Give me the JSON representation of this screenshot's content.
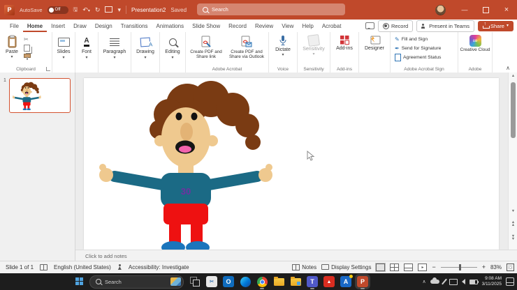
{
  "titlebar": {
    "autosave_label": "AutoSave",
    "autosave_state": "Off",
    "doc_title": "Presentation2",
    "doc_status": "Saved",
    "search_placeholder": "Search"
  },
  "tabs": {
    "items": [
      "File",
      "Home",
      "Insert",
      "Draw",
      "Design",
      "Transitions",
      "Animations",
      "Slide Show",
      "Record",
      "Review",
      "View",
      "Help",
      "Acrobat"
    ],
    "active": "Home",
    "record_button": "Record",
    "present_button": "Present in Teams",
    "share_button": "Share"
  },
  "ribbon": {
    "paste": "Paste",
    "clipboard_group": "Clipboard",
    "collapsed": [
      "Slides",
      "Font",
      "Paragraph",
      "Drawing",
      "Editing"
    ],
    "acrobat_btn1": "Create PDF and Share link",
    "acrobat_btn2": "Create PDF and Share via Outlook",
    "acrobat_group": "Adobe Acrobat",
    "dictate": "Dictate",
    "voice_group": "Voice",
    "sensitivity": "Sensitivity",
    "sensitivity_group": "Sensitivity",
    "addins": "Add-ins",
    "addins_group": "Add-ins",
    "designer": "Designer",
    "sign_items": [
      "Fill and Sign",
      "Send for Signature",
      "Agreement Status"
    ],
    "sign_group": "Adobe Acrobat Sign",
    "creative_cloud": "Creative Cloud",
    "adobe_group": "Adobe"
  },
  "slides_panel": {
    "slide_number": "1"
  },
  "slide": {
    "jersey_number": "30"
  },
  "notes_placeholder": "Click to add notes",
  "status": {
    "slide_indicator": "Slide 1 of 1",
    "language": "English (United States)",
    "accessibility": "Accessibility: Investigate",
    "notes_label": "Notes",
    "display_settings": "Display Settings",
    "zoom_level": "83%"
  },
  "taskbar": {
    "search_placeholder": "Search",
    "apps": [
      "start",
      "task-view",
      "snipping-tool",
      "outlook",
      "edge",
      "chrome",
      "file-explorer",
      "documents-folder",
      "teams",
      "acrobat",
      "a-app",
      "powerpoint"
    ],
    "tray": [
      "hidden-icons",
      "onedrive",
      "pen",
      "display",
      "volume",
      "battery"
    ],
    "time": "9:08 AM",
    "date": "3/11/2025"
  },
  "colors": {
    "titlebar": "#C0492B",
    "share_button": "#C0492B",
    "thumbnail_border": "#D35230",
    "shirt": "#1B6A85",
    "pants": "#EE1111",
    "shoes": "#1B75BC",
    "skin": "#EFC98F",
    "hair": "#7A3B13",
    "jersey_number": "#7030A0"
  }
}
